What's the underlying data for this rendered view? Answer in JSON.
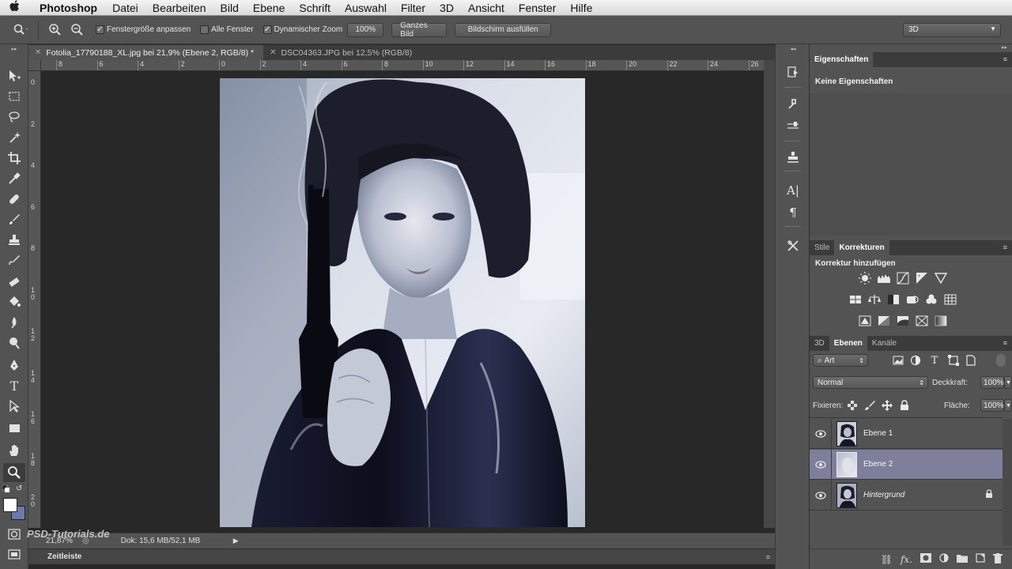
{
  "menubar": {
    "app_name": "Photoshop",
    "items": [
      "Datei",
      "Bearbeiten",
      "Bild",
      "Ebene",
      "Schrift",
      "Auswahl",
      "Filter",
      "3D",
      "Ansicht",
      "Fenster",
      "Hilfe"
    ]
  },
  "options_bar": {
    "fit_window_label": "Fenstergröße anpassen",
    "fit_window_checked": true,
    "all_windows_label": "Alle Fenster",
    "all_windows_checked": false,
    "dynamic_zoom_label": "Dynamischer Zoom",
    "dynamic_zoom_checked": true,
    "zoom_100_label": "100%",
    "fit_screen_label": "Ganzes Bild",
    "fill_screen_label": "Bildschirm ausfüllen",
    "workspace": "3D"
  },
  "document": {
    "tabs": [
      {
        "label": "Fotolia_17790188_XL.jpg bei 21,9% (Ebene 2, RGB/8) *",
        "active": true
      },
      {
        "label": "DSC04363.JPG bei 12,5% (RGB/8)",
        "active": false
      }
    ],
    "ruler_h_labels": [
      "8",
      "6",
      "4",
      "2",
      "0",
      "2",
      "4",
      "6",
      "8",
      "10",
      "12",
      "14",
      "16",
      "18",
      "20",
      "22",
      "24",
      "26"
    ],
    "ruler_v_labels": [
      "0",
      "2",
      "4",
      "6",
      "8",
      "1\n0",
      "1\n2",
      "1\n4",
      "1\n6",
      "1\n8",
      "2\n0"
    ],
    "zoom_value": "21,87%",
    "doc_size": "Dok: 15,6 MB/52,1 MB",
    "timeline_label": "Zeitleiste",
    "watermark": "PSD-Tutorials.de"
  },
  "properties_panel": {
    "tab_label": "Eigenschaften",
    "empty_text": "Keine Eigenschaften"
  },
  "adjustments_panel": {
    "tabs": [
      "Stile",
      "Korrekturen"
    ],
    "active_tab": "Korrekturen",
    "heading": "Korrektur hinzufügen",
    "row1": [
      "brightness-icon",
      "levels-icon",
      "curves-icon",
      "exposure-icon",
      "vibrance-icon"
    ],
    "row2": [
      "hue-saturation-icon",
      "color-balance-icon",
      "black-white-icon",
      "photo-filter-icon",
      "channel-mixer-icon",
      "color-lookup-icon"
    ],
    "row3": [
      "invert-icon",
      "posterize-icon",
      "threshold-icon",
      "selective-color-icon",
      "gradient-map-icon"
    ]
  },
  "layers_panel": {
    "tabs": [
      "3D",
      "Ebenen",
      "Kanäle"
    ],
    "active_tab": "Ebenen",
    "filter_kind": "Art",
    "blend_mode": "Normal",
    "opacity_label": "Deckkraft:",
    "opacity_value": "100%",
    "lock_label": "Fixieren:",
    "fill_label": "Fläche:",
    "fill_value": "100%",
    "layers": [
      {
        "name": "Ebene 1",
        "visible": true,
        "selected": false,
        "locked": false
      },
      {
        "name": "Ebene 2",
        "visible": true,
        "selected": true,
        "locked": false
      },
      {
        "name": "Hintergrund",
        "visible": true,
        "selected": false,
        "locked": true
      }
    ]
  },
  "colors": {
    "ui_panel": "#535353",
    "ui_dark": "#3b3b3b",
    "canvas_bg": "#282828",
    "selected_layer": "#7d7f9b"
  }
}
